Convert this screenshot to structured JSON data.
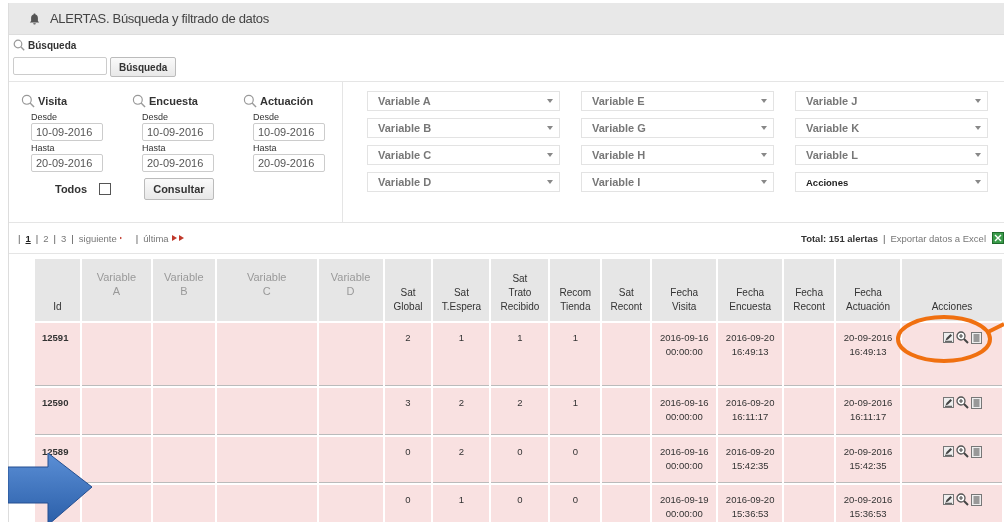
{
  "header": {
    "title": "ALERTAS. Búsqueda y filtrado de datos"
  },
  "search": {
    "label": "Búsqueda",
    "button": "Búsqueda"
  },
  "date_filters": [
    {
      "label": "Visita",
      "from_label": "Desde",
      "from": "10-09-2016",
      "to_label": "Hasta",
      "to": "20-09-2016"
    },
    {
      "label": "Encuesta",
      "from_label": "Desde",
      "from": "10-09-2016",
      "to_label": "Hasta",
      "to": "20-09-2016"
    },
    {
      "label": "Actuación",
      "from_label": "Desde",
      "from": "10-09-2016",
      "to_label": "Hasta",
      "to": "20-09-2016"
    }
  ],
  "todos": {
    "label": "Todos",
    "checked": false
  },
  "consult_button": "Consultar",
  "dropdowns": [
    {
      "placeholder": "Variable A"
    },
    {
      "placeholder": "Variable E"
    },
    {
      "placeholder": "Variable J"
    },
    {
      "placeholder": "Variable B"
    },
    {
      "placeholder": "Variable G"
    },
    {
      "placeholder": "Variable K"
    },
    {
      "placeholder": "Variable C"
    },
    {
      "placeholder": "Variable H"
    },
    {
      "placeholder": "Variable L"
    },
    {
      "placeholder": "Variable D"
    },
    {
      "placeholder": "Variable I"
    },
    {
      "value": "Acciones"
    }
  ],
  "pagination": [
    {
      "kind": "sep",
      "text": "|"
    },
    {
      "kind": "page",
      "text": "1",
      "selected": true
    },
    {
      "kind": "sep",
      "text": "|"
    },
    {
      "kind": "page",
      "text": "2",
      "selected": false
    },
    {
      "kind": "sep",
      "text": "|"
    },
    {
      "kind": "page",
      "text": "3",
      "selected": false
    },
    {
      "kind": "sep",
      "text": "|"
    },
    {
      "kind": "next",
      "text": "siguiente"
    },
    {
      "kind": "sep",
      "text": "|"
    },
    {
      "kind": "last",
      "text": "última"
    }
  ],
  "total": "Total: 151 alertas",
  "total_sep": "|",
  "export": "Exportar datos a Excel",
  "table": {
    "columns": [
      {
        "label": "Id",
        "muted": false
      },
      {
        "label": "Variable\nA",
        "muted": true
      },
      {
        "label": "Variable\nB",
        "muted": true
      },
      {
        "label": "Variable\nC",
        "muted": true
      },
      {
        "label": "Variable\nD",
        "muted": true
      },
      {
        "label": "Sat\nGlobal",
        "muted": false
      },
      {
        "label": "Sat\nT.Espera",
        "muted": false
      },
      {
        "label": "Sat\nTrato\nRecibido",
        "muted": false
      },
      {
        "label": "Recom\nTienda",
        "muted": false
      },
      {
        "label": "Sat\nRecont",
        "muted": false
      },
      {
        "label": "Fecha\nVisita",
        "muted": false
      },
      {
        "label": "Fecha\nEncuesta",
        "muted": false
      },
      {
        "label": "Fecha\nRecont",
        "muted": false
      },
      {
        "label": "Fecha\nActuación",
        "muted": false
      },
      {
        "label": "Acciones",
        "muted": false
      }
    ],
    "rows": [
      {
        "cells": [
          "12591",
          null,
          null,
          null,
          null,
          "2",
          "1",
          "1",
          "1",
          null,
          "2016-09-16\n00:00:00",
          "2016-09-20\n16:49:13",
          null,
          "20-09-2016\n16:49:13",
          null
        ]
      },
      {
        "cells": [
          "12590",
          null,
          null,
          null,
          null,
          "3",
          "2",
          "2",
          "1",
          null,
          "2016-09-16\n00:00:00",
          "2016-09-20\n16:11:17",
          null,
          "20-09-2016\n16:11:17",
          null
        ]
      },
      {
        "cells": [
          "12589",
          null,
          null,
          null,
          null,
          "0",
          "2",
          "0",
          "0",
          null,
          "2016-09-16\n00:00:00",
          "2016-09-20\n15:42:35",
          null,
          "20-09-2016\n15:42:35",
          null
        ]
      },
      {
        "cells": [
          null,
          null,
          null,
          null,
          null,
          "0",
          "1",
          "0",
          "0",
          null,
          "2016-09-19\n00:00:00",
          "2016-09-20\n15:36:53",
          null,
          "20-09-2016\n15:36:53",
          null
        ]
      }
    ]
  }
}
